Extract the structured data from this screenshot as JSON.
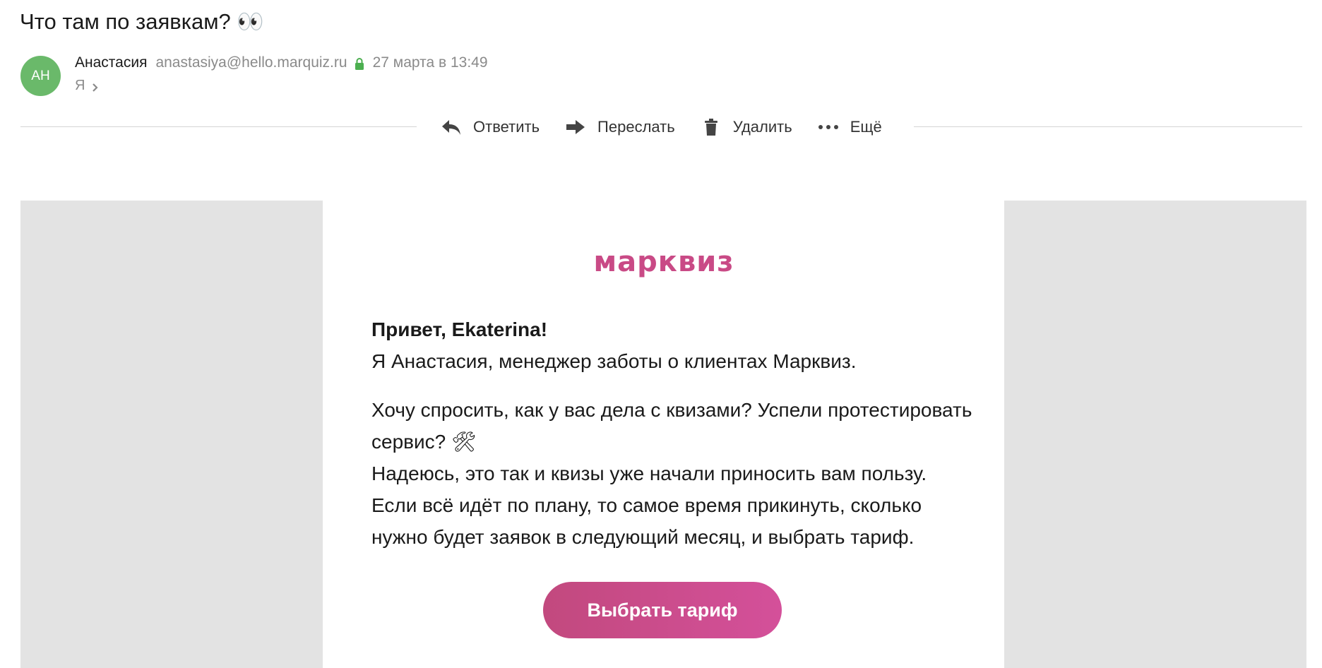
{
  "message": {
    "subject": "Что там по заявкам? 👀",
    "sender": {
      "initials": "АН",
      "name": "Анастасия",
      "email": "anastasiya@hello.marquiz.ru",
      "date": "27 марта в 13:49",
      "avatar_color": "#6ab96a"
    },
    "recipient": "Я"
  },
  "toolbar": {
    "reply_label": "Ответить",
    "forward_label": "Переслать",
    "delete_label": "Удалить",
    "more_label": "Ещё"
  },
  "email_content": {
    "brand": "марквиз",
    "greeting": "Привет, Ekaterina!",
    "intro": "Я Анастасия, менеджер заботы о клиентах Марквиз.",
    "paragraph_line1": "Хочу спросить, как у вас дела с квизами? Успели протестировать сервис? 🛠",
    "paragraph_line2": "Надеюсь, это так и квизы уже начали приносить вам пользу.",
    "paragraph_line3": "Если всё идёт по плану, то самое время прикинуть, сколько нужно будет заявок в следующий месяц, и выбрать тариф.",
    "cta_label": "Выбрать тариф",
    "brand_color": "#c94a86"
  }
}
